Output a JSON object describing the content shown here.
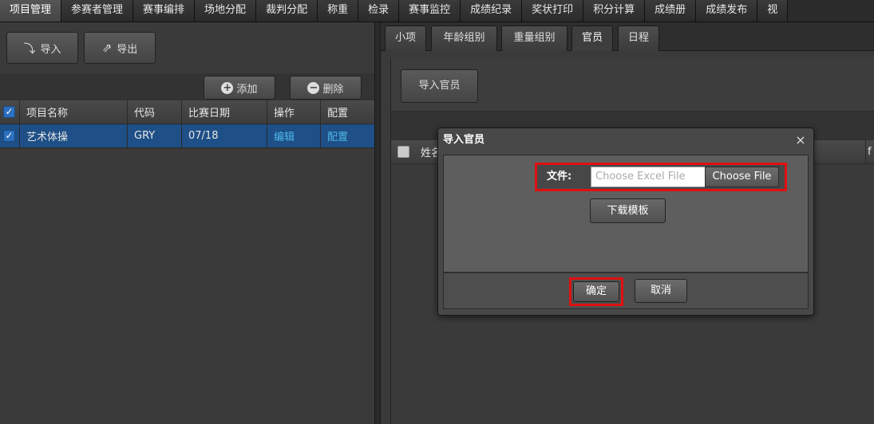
{
  "top_menu": [
    "项目管理",
    "参赛者管理",
    "赛事编排",
    "场地分配",
    "裁判分配",
    "称重",
    "检录",
    "赛事监控",
    "成绩纪录",
    "奖状打印",
    "积分计算",
    "成绩册",
    "成绩发布",
    "视"
  ],
  "left_toolbar": {
    "import_label": "导入",
    "export_label": "导出",
    "add_label": "添加",
    "delete_label": "删除"
  },
  "project_grid": {
    "columns": [
      "项目名称",
      "代码",
      "比赛日期",
      "操作",
      "配置"
    ],
    "rows": [
      {
        "name": "艺术体操",
        "code": "GRY",
        "date": "07/18",
        "action": "编辑",
        "config": "配置"
      }
    ]
  },
  "right_tabs": [
    "小项",
    "年龄组别",
    "重量组别",
    "官员",
    "日程"
  ],
  "right_panel": {
    "import_officials_label": "导入官员",
    "header_name_partial": "姓名",
    "header_right_partial": "f"
  },
  "dialog": {
    "title": "导入官员",
    "close_glyph": "×",
    "file_label": "文件:",
    "file_placeholder": "Choose Excel File",
    "choose_file_label": "Choose File",
    "download_template_label": "下载模板",
    "ok_label": "确定",
    "cancel_label": "取消"
  },
  "colors": {
    "selected_row": "#1e4f86",
    "highlight_red": "#e01010",
    "link_blue": "#4db8e8"
  }
}
